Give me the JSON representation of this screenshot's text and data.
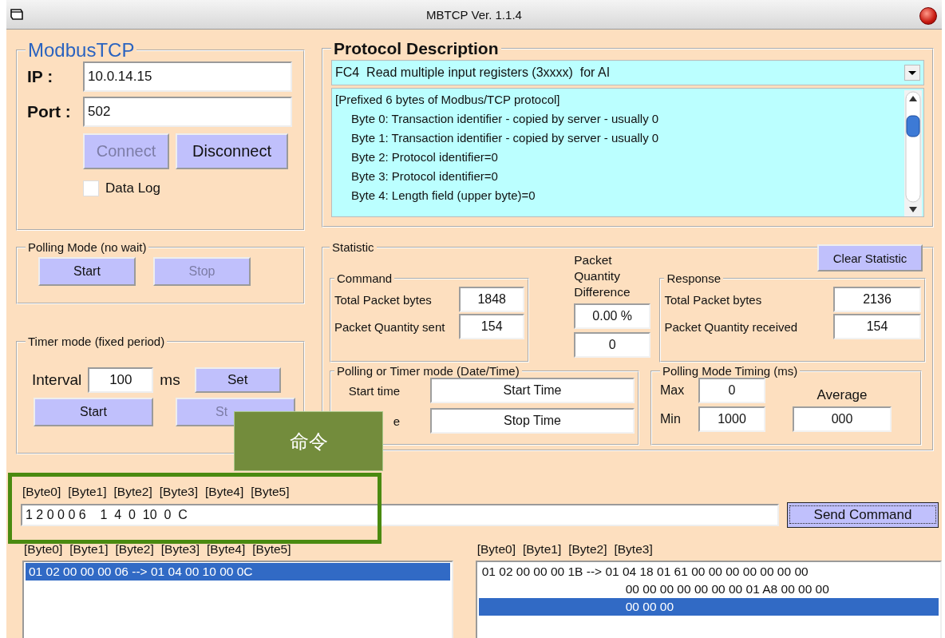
{
  "window": {
    "title": "MBTCP  Ver. 1.1.4"
  },
  "connection": {
    "title": "ModbusTCP",
    "ip_label": "IP :",
    "ip": "10.0.14.15",
    "port_label": "Port :",
    "port": "502",
    "buttons": [
      {
        "label": "Connect",
        "disabled": true
      },
      {
        "label": "Disconnect",
        "disabled": false
      }
    ],
    "data_log": {
      "label": "Data Log",
      "checked": false
    }
  },
  "protocol": {
    "title": "Protocol Description",
    "function": "FC4  Read multiple input registers (3xxxx)  for AI",
    "lines": [
      {
        "text": "[Prefixed 6 bytes of Modbus/TCP protocol]",
        "indented": false
      },
      {
        "text": "Byte 0: Transaction identifier - copied by server - usually 0",
        "indented": true
      },
      {
        "text": "Byte 1: Transaction identifier - copied by server - usually 0",
        "indented": true
      },
      {
        "text": "Byte 2: Protocol identifier=0",
        "indented": true
      },
      {
        "text": "Byte 3: Protocol identifier=0",
        "indented": true
      },
      {
        "text": "Byte 4: Length field (upper byte)=0",
        "indented": true
      }
    ]
  },
  "polling_mode": {
    "title": "Polling Mode (no wait)",
    "buttons": [
      {
        "label": "Start",
        "disabled": false
      },
      {
        "label": "Stop",
        "disabled": true
      }
    ]
  },
  "timer_mode": {
    "title": "Timer mode (fixed period)",
    "interval_label": "Interval",
    "interval": "100",
    "unit": "ms",
    "set_button": "Set",
    "buttons": [
      {
        "label": "Start",
        "disabled": false
      },
      {
        "label": "St",
        "disabled": true
      }
    ]
  },
  "statistic": {
    "title": "Statistic",
    "clear_button": "Clear Statistic",
    "command": {
      "title": "Command",
      "rows": [
        {
          "label": "Total Packet bytes",
          "value": "1848"
        },
        {
          "label": "Packet Quantity sent",
          "value": "154"
        }
      ]
    },
    "difference": {
      "title": "Packet Quantity Difference",
      "values": [
        "0.00 %",
        "0"
      ]
    },
    "response": {
      "title": "Response",
      "rows": [
        {
          "label": "Total Packet bytes",
          "value": "2136"
        },
        {
          "label": "Packet Quantity received",
          "value": "154"
        }
      ]
    },
    "date_time": {
      "title": "Polling  or Timer mode  (Date/Time)",
      "rows": [
        {
          "label": "Start time",
          "value": "Start Time"
        },
        {
          "label": "e",
          "value": "Stop Time"
        }
      ]
    },
    "timing": {
      "title": "Polling Mode Timing (ms)",
      "max_label": "Max",
      "max": "0",
      "min_label": "Min",
      "min": "1000",
      "average_label": "Average",
      "average": "000"
    }
  },
  "command": {
    "byte_labels": [
      "[Byte0]",
      "[Byte1]",
      "[Byte2]",
      "[Byte3]",
      "[Byte4]",
      "[Byte5]"
    ],
    "value": "1 2 0 0 0 6    1  4  0  10  0  C",
    "send_button": "Send Command"
  },
  "request_log": {
    "byte_labels": [
      "[Byte0]",
      "[Byte1]",
      "[Byte2]",
      "[Byte3]",
      "[Byte4]",
      "[Byte5]"
    ],
    "rows": [
      {
        "text": "01 02 00 00 00 06 --> 01 04 00 10 00 0C",
        "selected": true,
        "continuation": false
      }
    ]
  },
  "response_log": {
    "byte_labels": [
      "[Byte0]",
      "[Byte1]",
      "[Byte2]",
      "[Byte3]"
    ],
    "rows": [
      {
        "text": "01 02 00 00 00 1B --> 01 04 18 01 61 00 00 00 00 00 00 00",
        "selected": false,
        "continuation": false
      },
      {
        "text": "00 00 00 00 00 00 00 01 A8 00 00 00",
        "selected": false,
        "continuation": true
      },
      {
        "text": "00 00 00",
        "selected": true,
        "continuation": true
      }
    ]
  },
  "annotation": {
    "label": "命令"
  }
}
